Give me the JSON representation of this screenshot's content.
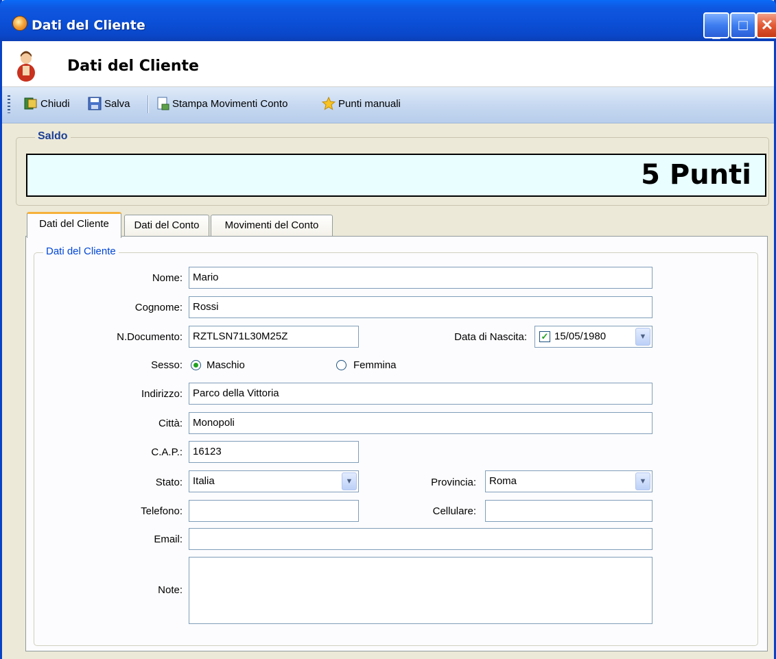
{
  "window": {
    "title": "Dati del Cliente"
  },
  "header": {
    "title": "Dati del Cliente"
  },
  "toolbar": {
    "close_label": "Chiudi",
    "save_label": "Salva",
    "print_label": "Stampa Movimenti Conto",
    "points_label": "Punti manuali"
  },
  "saldo": {
    "legend": "Saldo",
    "value": "5 Punti"
  },
  "tabs": [
    {
      "label": "Dati del Cliente",
      "active": true
    },
    {
      "label": "Dati del Conto",
      "active": false
    },
    {
      "label": "Movimenti del Conto",
      "active": false
    }
  ],
  "form": {
    "group_legend": "Dati del Cliente",
    "nome": {
      "label": "Nome:",
      "value": "Mario"
    },
    "cognome": {
      "label": "Cognome:",
      "value": "Rossi"
    },
    "documento": {
      "label": "N.Documento:",
      "value": "RZTLSN71L30M25Z"
    },
    "nascita": {
      "label": "Data di Nascita:",
      "value": "15/05/1980",
      "checked": true
    },
    "sesso": {
      "label": "Sesso:",
      "option_male": "Maschio",
      "option_female": "Femmina",
      "selected": "Maschio"
    },
    "indirizzo": {
      "label": "Indirizzo:",
      "value": "Parco della Vittoria"
    },
    "citta": {
      "label": "Città:",
      "value": "Monopoli"
    },
    "cap": {
      "label": "C.A.P.:",
      "value": "16123"
    },
    "stato": {
      "label": "Stato:",
      "value": "Italia"
    },
    "provincia": {
      "label": "Provincia:",
      "value": "Roma"
    },
    "telefono": {
      "label": "Telefono:",
      "value": ""
    },
    "cellulare": {
      "label": "Cellulare:",
      "value": ""
    },
    "email": {
      "label": "Email:",
      "value": ""
    },
    "note": {
      "label": "Note:",
      "value": ""
    }
  },
  "colors": {
    "title_blue": "#0b4fd7",
    "saldo_bg": "#e8feff",
    "legend_blue": "#1c3f94",
    "tab_highlight": "#f6b13a"
  }
}
